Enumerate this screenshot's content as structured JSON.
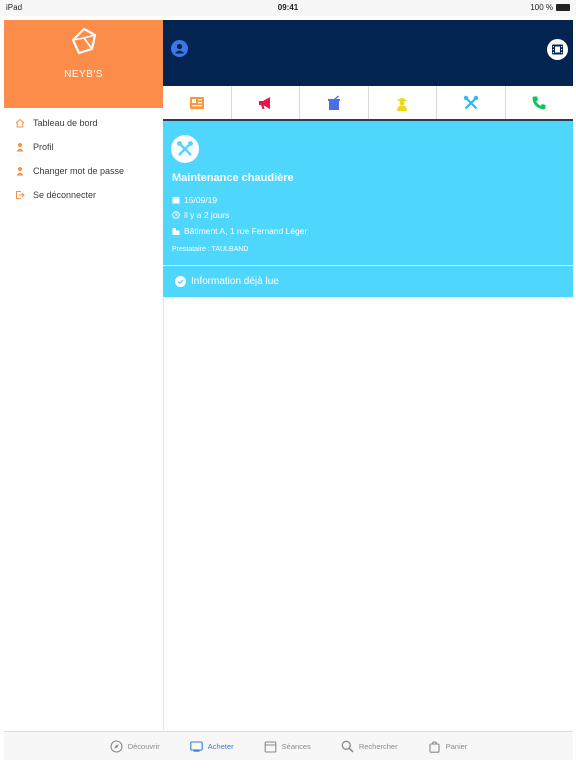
{
  "status_bar": {
    "device": "iPad",
    "time": "09:41",
    "battery": "100 %"
  },
  "sidebar": {
    "brand_name": "NEYB'S",
    "items": [
      {
        "label": "Tableau de bord",
        "icon": "home-icon"
      },
      {
        "label": "Profil",
        "icon": "person-icon"
      },
      {
        "label": "Changer mot de passe",
        "icon": "person-icon"
      },
      {
        "label": "Se déconnecter",
        "icon": "logout-icon"
      }
    ]
  },
  "topbar": {
    "left_icon": "user-circle-icon",
    "right_icon": "film-icon"
  },
  "categories": [
    {
      "icon": "news-icon",
      "color": "#f9963e"
    },
    {
      "icon": "megaphone-icon",
      "color": "#e8174b"
    },
    {
      "icon": "trash-icon",
      "color": "#4b6ee8"
    },
    {
      "icon": "worker-icon",
      "color": "#e8db1a"
    },
    {
      "icon": "tools-icon",
      "color": "#2fb8f3"
    },
    {
      "icon": "phone-icon",
      "color": "#11c45a"
    }
  ],
  "card": {
    "icon": "tools-icon",
    "title": "Maintenance chaudière",
    "date": "15/09/19",
    "relative_time": "il y a 2 jours",
    "location": "Bâtiment A, 1 rue Fernand Léger",
    "provider": "Prestataire : TAULBAND",
    "read_status": "Information déjà lue",
    "background": "#4fd6fc"
  },
  "tab_bar": {
    "tabs": [
      {
        "label": "Découvrir",
        "icon": "compass-icon",
        "active": false
      },
      {
        "label": "Acheter",
        "icon": "screen-icon",
        "active": true
      },
      {
        "label": "Séances",
        "icon": "calendar-icon",
        "active": false
      },
      {
        "label": "Rechercher",
        "icon": "search-icon",
        "active": false
      },
      {
        "label": "Panier",
        "icon": "bag-icon",
        "active": false
      }
    ]
  },
  "colors": {
    "brand": "#fb8c4a",
    "topbar": "#032350",
    "accent": "#3b7bd5"
  }
}
